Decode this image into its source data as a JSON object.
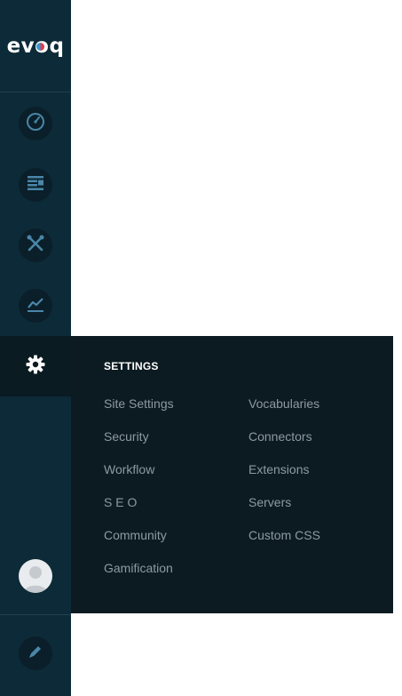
{
  "brand": {
    "logo_text": "evoq"
  },
  "sidebar": {
    "items": [
      {
        "icon": "dashboard-gauge-icon"
      },
      {
        "icon": "content-icon"
      },
      {
        "icon": "tools-icon"
      },
      {
        "icon": "analytics-chart-icon"
      },
      {
        "icon": "settings-gear-icon",
        "active": true
      }
    ],
    "user_avatar_icon": "user-avatar-icon",
    "edit_icon": "pencil-edit-icon"
  },
  "settings_menu": {
    "title": "SETTINGS",
    "column1": [
      "Site Settings",
      "Security",
      "Workflow",
      "S E O",
      "Community",
      "Gamification"
    ],
    "column2": [
      "Vocabularies",
      "Connectors",
      "Extensions",
      "Servers",
      "Custom CSS"
    ]
  },
  "colors": {
    "sidebar_bg": "#0d2a38",
    "flyout_bg": "#0c1b22",
    "icon_blue": "#4a86a8",
    "link_text": "#8d9aa1"
  }
}
